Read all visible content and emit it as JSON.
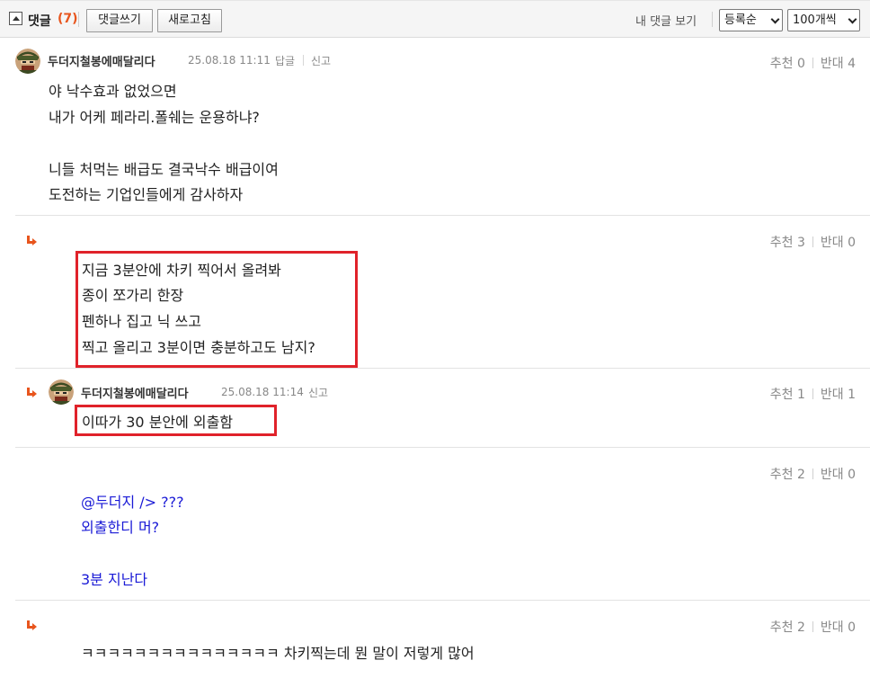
{
  "header": {
    "title": "댓글",
    "count": "(7)",
    "write_label": "댓글쓰기",
    "refresh_label": "새로고침",
    "my_comments_label": "내 댓글 보기",
    "sort_value": "등록순",
    "per_page_value": "100개씩"
  },
  "comments": [
    {
      "nick": "두더지철봉에매달리다",
      "date": "25.08.18 11:11",
      "reply_label": "답글",
      "report_label": "신고",
      "up_label": "추천",
      "up": "0",
      "down_label": "반대",
      "down": "4",
      "lines": [
        "야 낙수효과 없었으면",
        "내가 어케 페라리.폴쉐는 운용하냐?",
        "",
        "니들 처먹는 배급도 결국낙수 배급이여",
        "도전하는 기업인들에게 감사하자"
      ]
    },
    {
      "up_label": "추천",
      "up": "3",
      "down_label": "반대",
      "down": "0",
      "lines": [
        "지금 3분안에 차키 찍어서 올려봐",
        "종이 쪼가리 한장",
        "펜하나 집고 닉 쓰고",
        "찍고 올리고 3분이면 충분하고도 남지?"
      ]
    },
    {
      "nick": "두더지철봉에매달리다",
      "date": "25.08.18 11:14",
      "report_label": "신고",
      "up_label": "추천",
      "up": "1",
      "down_label": "반대",
      "down": "1",
      "lines": [
        "이따가 30 분안에 외출함"
      ]
    },
    {
      "up_label": "추천",
      "up": "2",
      "down_label": "반대",
      "down": "0",
      "lines": [
        "@두더지 /> ???",
        "외출한디 머?",
        "",
        "3분 지난다"
      ]
    },
    {
      "up_label": "추천",
      "up": "2",
      "down_label": "반대",
      "down": "0",
      "lines": [
        "ㅋㅋㅋㅋㅋㅋㅋㅋㅋㅋㅋㅋㅋㅋㅋ 차키찍는데 뭔 말이 저렇게 많어"
      ]
    }
  ],
  "colors": {
    "accent": "#e8551d",
    "highlight": "#e0222a",
    "mention_blue": "#1a1ad6"
  }
}
